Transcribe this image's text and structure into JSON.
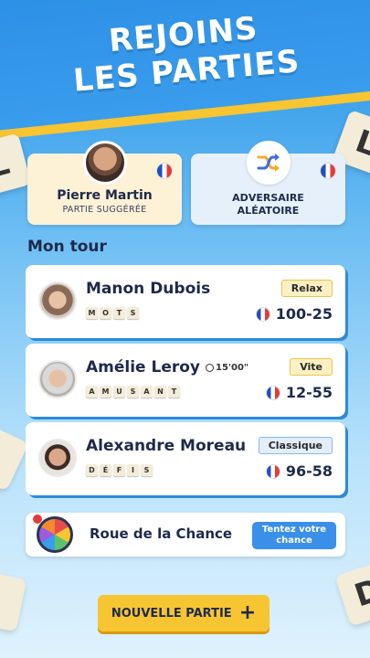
{
  "headline": {
    "line1": "REJOINS",
    "line2": "LES PARTIES"
  },
  "suggested": {
    "name": "Pierre Martin",
    "subtitle": "PARTIE SUGGÉRÉE"
  },
  "random": {
    "line1": "ADVERSAIRE",
    "line2": "ALÉATOIRE"
  },
  "section_title": "Mon tour",
  "games": [
    {
      "name": "Manon Dubois",
      "tiles": [
        "M",
        "O",
        "T",
        "S"
      ],
      "mode": "Relax",
      "score": "100-25",
      "timer": ""
    },
    {
      "name": "Amélie Leroy",
      "tiles": [
        "A",
        "M",
        "U",
        "S",
        "A",
        "N",
        "T"
      ],
      "mode": "Vite",
      "score": "12-55",
      "timer": "15'00\""
    },
    {
      "name": "Alexandre Moreau",
      "tiles": [
        "D",
        "É",
        "F",
        "I",
        "S"
      ],
      "mode": "Classique",
      "score": "96-58",
      "timer": ""
    }
  ],
  "wheel": {
    "title": "Roue de la Chance",
    "button": "Tentez votre chance"
  },
  "new_game": {
    "label": "NOUVELLE PARTIE",
    "icon": "plus-icon"
  },
  "background_tiles": [
    "L",
    "D"
  ],
  "colors": {
    "accent_yellow": "#f7c531",
    "primary_blue": "#2b8fe6",
    "text_dark": "#1e2a4a"
  }
}
